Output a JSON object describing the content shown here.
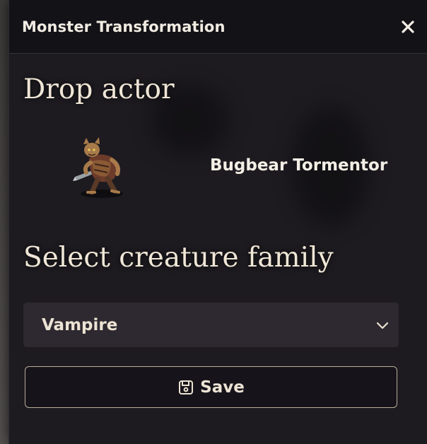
{
  "window": {
    "title": "Monster Transformation",
    "close_icon": "close-icon"
  },
  "drop_section": {
    "heading": "Drop actor",
    "actor": {
      "name": "Bugbear Tormentor",
      "portrait_icon": "bugbear-portrait-icon"
    }
  },
  "family_section": {
    "heading": "Select creature family",
    "selected": "Vampire",
    "dropdown_icon": "chevron-down-icon"
  },
  "save_button": {
    "label": "Save",
    "icon": "floppy-disk-icon"
  },
  "colors": {
    "window_bg": "#1d1b20",
    "header_bg": "#131217",
    "select_bg": "#2e2930",
    "button_border": "#b9ad98",
    "text": "#efe6d6"
  }
}
